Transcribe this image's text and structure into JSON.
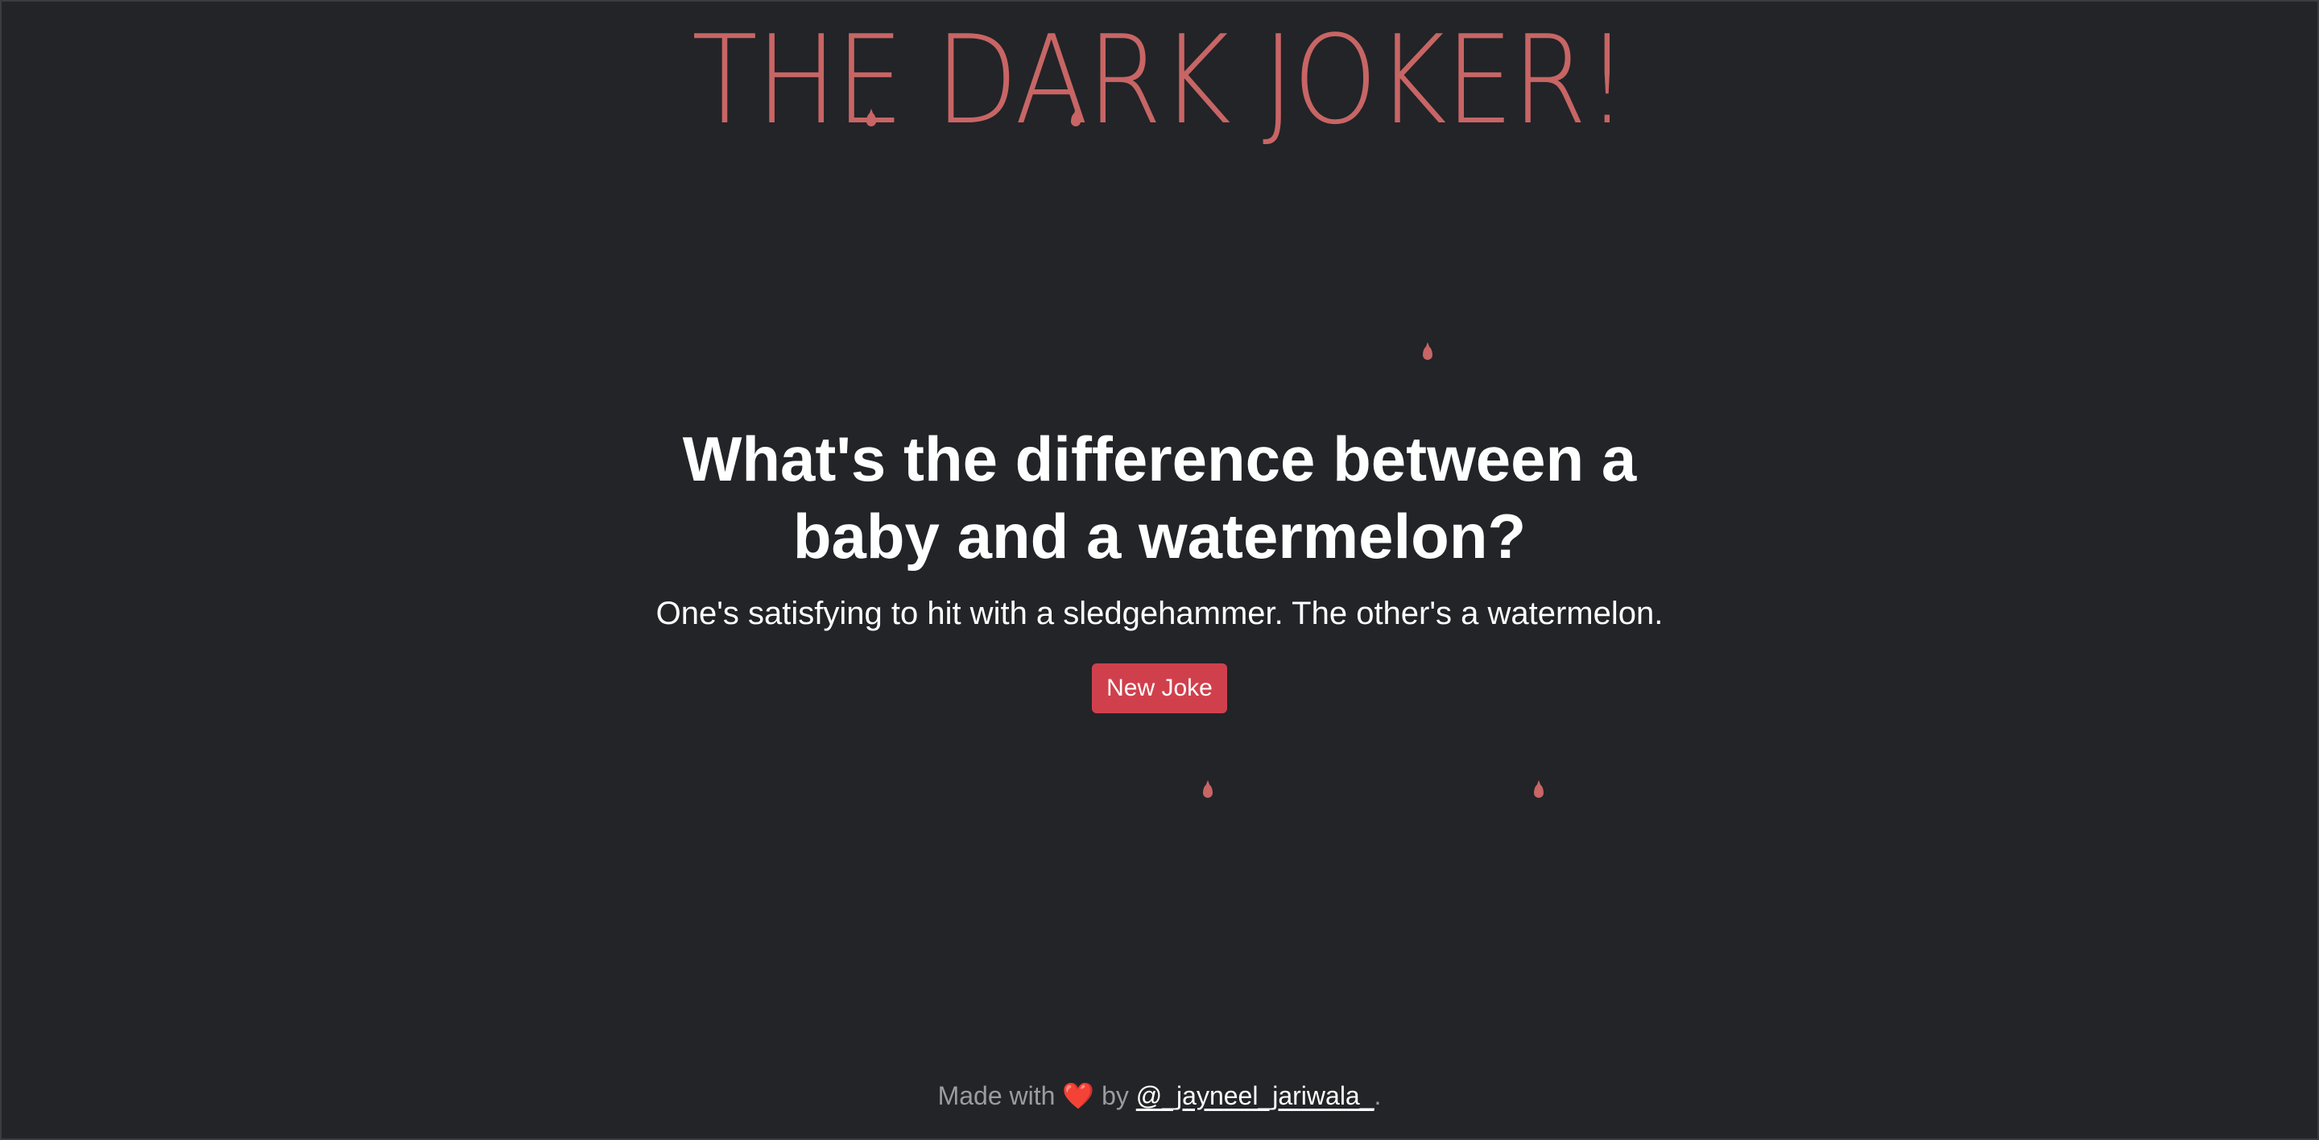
{
  "header": {
    "brand": "THE DARK JOKER!",
    "accent_color": "#c86565"
  },
  "joke": {
    "question": "What's the difference between a baby and a watermelon?",
    "answer": "One's satisfying to hit with a sledgehammer. The other's a watermelon."
  },
  "actions": {
    "new_joke_label": "New Joke",
    "button_color": "#d0404c"
  },
  "footer": {
    "made_with": "Made with",
    "heart": "❤️",
    "by": "by",
    "author_link": "@_jayneel_jariwala_",
    "period": "."
  },
  "decorations": {
    "drip_icon": "blood-drop-icon"
  }
}
